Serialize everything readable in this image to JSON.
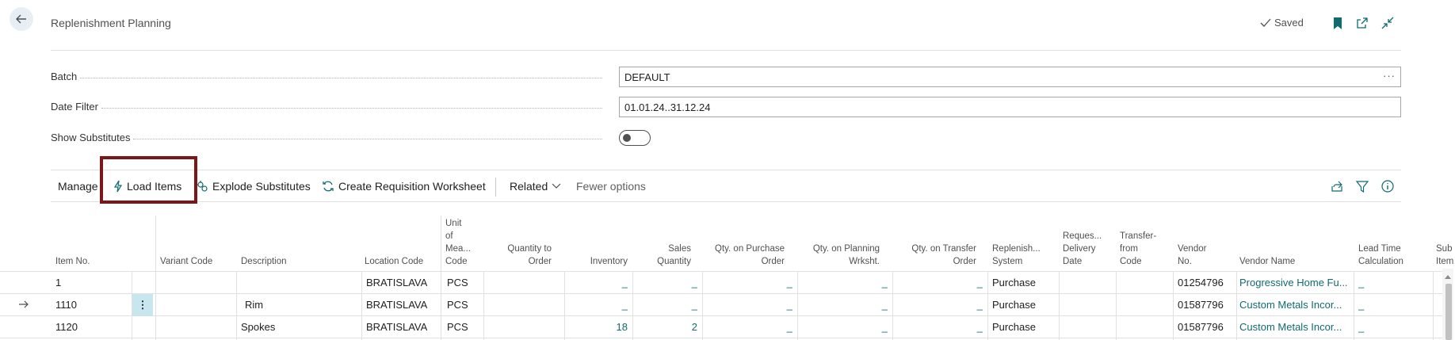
{
  "header": {
    "title": "Replenishment Planning",
    "saved_label": "Saved"
  },
  "fields": {
    "batch_label": "Batch",
    "batch_value": "DEFAULT",
    "date_filter_label": "Date Filter",
    "date_filter_value": "01.01.24..31.12.24",
    "show_substitutes_label": "Show Substitutes",
    "show_substitutes_on": false
  },
  "actions": {
    "manage": "Manage",
    "load_items": "Load Items",
    "explode_substitutes": "Explode Substitutes",
    "create_requisition_worksheet": "Create Requisition Worksheet",
    "related": "Related",
    "fewer_options": "Fewer options"
  },
  "columns": {
    "item_no": "Item No.",
    "variant_code": "Variant Code",
    "description": "Description",
    "location_code": "Location Code",
    "uom_1": "Unit",
    "uom_2": "of",
    "uom_3": "Mea...",
    "uom_4": "Code",
    "qty_to_order_1": "Quantity to",
    "qty_to_order_2": "Order",
    "inventory": "Inventory",
    "sales_qty_1": "Sales",
    "sales_qty_2": "Quantity",
    "qty_purchase_1": "Qty. on Purchase",
    "qty_purchase_2": "Order",
    "qty_planning_1": "Qty. on Planning",
    "qty_planning_2": "Wrksht.",
    "qty_transfer_1": "Qty. on Transfer",
    "qty_transfer_2": "Order",
    "replenish_1": "Replenish...",
    "replenish_2": "System",
    "req_delivery_1": "Reques...",
    "req_delivery_2": "Delivery",
    "req_delivery_3": "Date",
    "transfer_from_1": "Transfer-",
    "transfer_from_2": "from",
    "transfer_from_3": "Code",
    "vendor_no_1": "Vendor",
    "vendor_no_2": "No.",
    "vendor_name": "Vendor Name",
    "lead_time_1": "Lead Time",
    "lead_time_2": "Calculation",
    "sub_1": "Sub",
    "sub_2": "Item"
  },
  "rows": [
    {
      "item_no": "1",
      "description": "",
      "location": "BRATISLAVA",
      "uom": "PCS",
      "qty_to_order": "",
      "inventory": "_",
      "sales_qty": "_",
      "qty_purchase": "_",
      "qty_planning": "_",
      "qty_transfer": "_",
      "replenish": "Purchase",
      "vendor_no": "01254796",
      "vendor_name": "Progressive Home Fu...",
      "lead_time": "_"
    },
    {
      "item_no": "1110",
      "description": "Rim",
      "location": "BRATISLAVA",
      "uom": "PCS",
      "qty_to_order": "",
      "inventory": "_",
      "sales_qty": "_",
      "qty_purchase": "_",
      "qty_planning": "_",
      "qty_transfer": "_",
      "replenish": "Purchase",
      "vendor_no": "01587796",
      "vendor_name": "Custom Metals Incor...",
      "lead_time": "_"
    },
    {
      "item_no": "1120",
      "description": "Spokes",
      "location": "BRATISLAVA",
      "uom": "PCS",
      "qty_to_order": "",
      "inventory": "18",
      "sales_qty": "2",
      "qty_purchase": "_",
      "qty_planning": "_",
      "qty_transfer": "_",
      "replenish": "Purchase",
      "vendor_no": "01587796",
      "vendor_name": "Custom Metals Incor...",
      "lead_time": "_"
    }
  ],
  "icons": {
    "back": "arrow-left-icon",
    "saved": "checkmark-icon",
    "bookmark": "bookmark-icon",
    "open_new": "open-in-new-window-icon",
    "collapse": "collapse-icon",
    "share": "share-icon",
    "filter": "filter-icon",
    "info": "info-icon",
    "row_indicator": "arrow-right-icon",
    "row_menu": "more-vertical-icon"
  },
  "colors": {
    "accent": "#0f6b70",
    "highlight_border": "#7e1518",
    "selected_cell": "#c7e6ee"
  }
}
